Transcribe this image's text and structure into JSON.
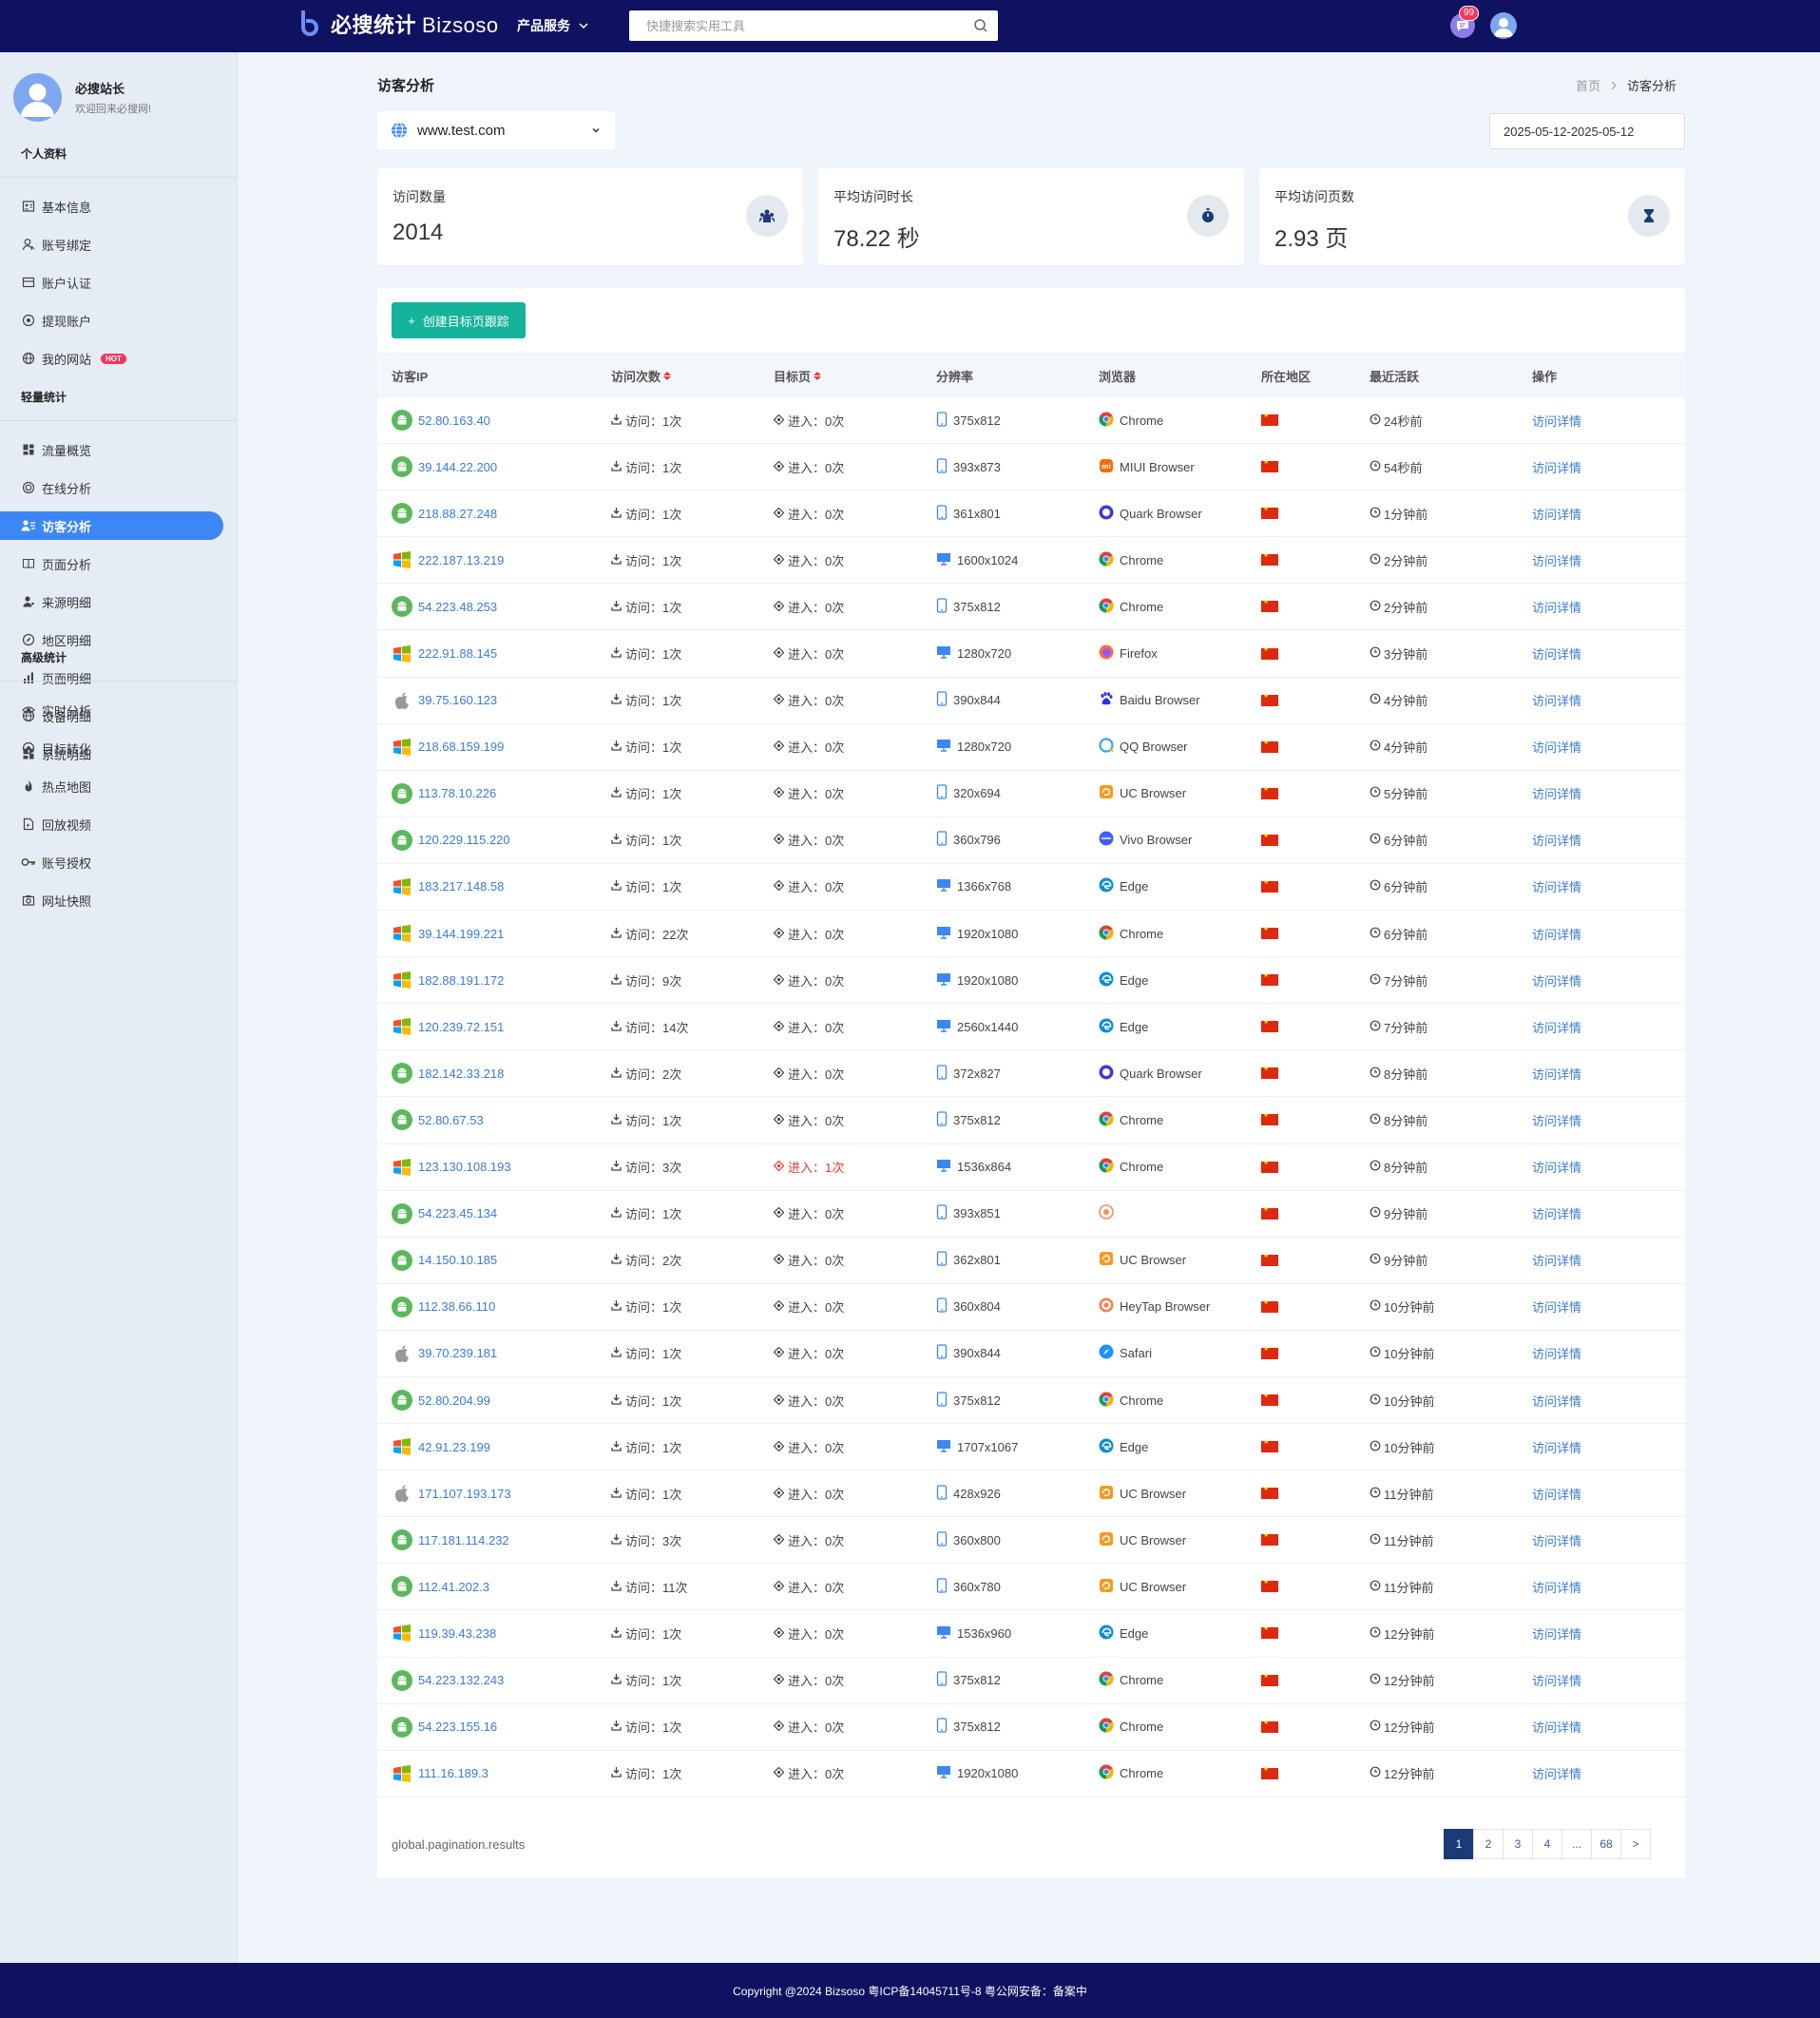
{
  "header": {
    "logo_cn": "必搜统计",
    "logo_en": "Bizsoso",
    "product_menu": "产品服务",
    "search_placeholder": "快捷搜索实用工具",
    "message_badge": "99"
  },
  "sidebar": {
    "user_name": "必搜站长",
    "user_welcome": "欢迎回来必搜网!",
    "sections": [
      {
        "title": "个人资料",
        "items": [
          {
            "label": "基本信息",
            "icon": "id-card-icon"
          },
          {
            "label": "账号绑定",
            "icon": "user-icon"
          },
          {
            "label": "账户认证",
            "icon": "card-icon"
          },
          {
            "label": "提现账户",
            "icon": "target-icon"
          },
          {
            "label": "我的网站",
            "icon": "globe-icon",
            "badge": "HOT"
          }
        ]
      },
      {
        "title": "轻量统计",
        "items": [
          {
            "label": "流量概览",
            "icon": "dashboard-icon"
          },
          {
            "label": "在线分析",
            "icon": "online-icon"
          },
          {
            "label": "访客分析",
            "icon": "users-icon",
            "active": true
          },
          {
            "label": "页面分析",
            "icon": "book-icon"
          },
          {
            "label": "来源明细",
            "icon": "person-icon"
          },
          {
            "label": "地区明细",
            "icon": "compass-icon"
          },
          {
            "label": "页面明细",
            "icon": "bar-chart-icon"
          },
          {
            "label": "设备明细",
            "icon": "globe-icon"
          },
          {
            "label": "系统明细",
            "icon": "dashboard-icon"
          }
        ]
      },
      {
        "title": "高级统计",
        "items": [
          {
            "label": "实时分析",
            "icon": "eye-icon"
          },
          {
            "label": "目标转化",
            "icon": "target-icon"
          },
          {
            "label": "热点地图",
            "icon": "flame-icon"
          },
          {
            "label": "回放视频",
            "icon": "file-icon"
          },
          {
            "label": "账号授权",
            "icon": "key-icon"
          },
          {
            "label": "网址快照",
            "icon": "camera-icon"
          }
        ]
      }
    ]
  },
  "page": {
    "title": "访客分析",
    "breadcrumb_home": "首页",
    "breadcrumb_current": "访客分析",
    "site": "www.test.com",
    "date_range": "2025-05-12-2025-05-12"
  },
  "stats": [
    {
      "label": "访问数量",
      "value": "2014",
      "icon": "visitors-icon"
    },
    {
      "label": "平均访问时长",
      "value": "78.22 秒",
      "icon": "stopwatch-icon"
    },
    {
      "label": "平均访问页数",
      "value": "2.93 页",
      "icon": "hourglass-icon"
    }
  ],
  "table": {
    "create_button": "创建目标页跟踪",
    "columns": [
      "访客IP",
      "访问次数",
      "目标页",
      "分辨率",
      "浏览器",
      "所在地区",
      "最近活跃",
      "操作"
    ],
    "visit_prefix": "访问：",
    "enter_prefix": "进入：",
    "detail_label": "访问详情",
    "rows": [
      {
        "os": "android",
        "ip": "52.80.163.40",
        "visits": "1次",
        "target": "0次",
        "device": "mobile",
        "res": "375x812",
        "browser": "Chrome",
        "bicon": "chrome",
        "time": "24秒前"
      },
      {
        "os": "android",
        "ip": "39.144.22.200",
        "visits": "1次",
        "target": "0次",
        "device": "mobile",
        "res": "393x873",
        "browser": "MIUI Browser",
        "bicon": "miui",
        "time": "54秒前"
      },
      {
        "os": "android",
        "ip": "218.88.27.248",
        "visits": "1次",
        "target": "0次",
        "device": "mobile",
        "res": "361x801",
        "browser": "Quark Browser",
        "bicon": "quark",
        "time": "1分钟前"
      },
      {
        "os": "windows",
        "ip": "222.187.13.219",
        "visits": "1次",
        "target": "0次",
        "device": "desktop",
        "res": "1600x1024",
        "browser": "Chrome",
        "bicon": "chrome",
        "time": "2分钟前"
      },
      {
        "os": "android",
        "ip": "54.223.48.253",
        "visits": "1次",
        "target": "0次",
        "device": "mobile",
        "res": "375x812",
        "browser": "Chrome",
        "bicon": "chrome",
        "time": "2分钟前"
      },
      {
        "os": "windows",
        "ip": "222.91.88.145",
        "visits": "1次",
        "target": "0次",
        "device": "desktop",
        "res": "1280x720",
        "browser": "Firefox",
        "bicon": "firefox",
        "time": "3分钟前"
      },
      {
        "os": "apple",
        "ip": "39.75.160.123",
        "visits": "1次",
        "target": "0次",
        "device": "mobile",
        "res": "390x844",
        "browser": "Baidu Browser",
        "bicon": "baidu",
        "time": "4分钟前"
      },
      {
        "os": "windows",
        "ip": "218.68.159.199",
        "visits": "1次",
        "target": "0次",
        "device": "desktop",
        "res": "1280x720",
        "browser": "QQ Browser",
        "bicon": "qq",
        "time": "4分钟前"
      },
      {
        "os": "android",
        "ip": "113.78.10.226",
        "visits": "1次",
        "target": "0次",
        "device": "mobile",
        "res": "320x694",
        "browser": "UC Browser",
        "bicon": "uc",
        "time": "5分钟前"
      },
      {
        "os": "android",
        "ip": "120.229.115.220",
        "visits": "1次",
        "target": "0次",
        "device": "mobile",
        "res": "360x796",
        "browser": "Vivo Browser",
        "bicon": "vivo",
        "time": "6分钟前"
      },
      {
        "os": "windows",
        "ip": "183.217.148.58",
        "visits": "1次",
        "target": "0次",
        "device": "desktop",
        "res": "1366x768",
        "browser": "Edge",
        "bicon": "edge",
        "time": "6分钟前"
      },
      {
        "os": "windows",
        "ip": "39.144.199.221",
        "visits": "22次",
        "target": "0次",
        "device": "desktop",
        "res": "1920x1080",
        "browser": "Chrome",
        "bicon": "chrome",
        "time": "6分钟前"
      },
      {
        "os": "windows",
        "ip": "182.88.191.172",
        "visits": "9次",
        "target": "0次",
        "device": "desktop",
        "res": "1920x1080",
        "browser": "Edge",
        "bicon": "edge",
        "time": "7分钟前"
      },
      {
        "os": "windows",
        "ip": "120.239.72.151",
        "visits": "14次",
        "target": "0次",
        "device": "desktop",
        "res": "2560x1440",
        "browser": "Edge",
        "bicon": "edge",
        "time": "7分钟前"
      },
      {
        "os": "android",
        "ip": "182.142.33.218",
        "visits": "2次",
        "target": "0次",
        "device": "mobile",
        "res": "372x827",
        "browser": "Quark Browser",
        "bicon": "quark",
        "time": "8分钟前"
      },
      {
        "os": "android",
        "ip": "52.80.67.53",
        "visits": "1次",
        "target": "0次",
        "device": "mobile",
        "res": "375x812",
        "browser": "Chrome",
        "bicon": "chrome",
        "time": "8分钟前"
      },
      {
        "os": "windows",
        "ip": "123.130.108.193",
        "visits": "3次",
        "target": "1次",
        "hit": true,
        "device": "desktop",
        "res": "1536x864",
        "browser": "Chrome",
        "bicon": "chrome",
        "time": "8分钟前"
      },
      {
        "os": "android",
        "ip": "54.223.45.134",
        "visits": "1次",
        "target": "0次",
        "device": "mobile",
        "res": "393x851",
        "browser": "",
        "bicon": "unknown",
        "time": "9分钟前"
      },
      {
        "os": "android",
        "ip": "14.150.10.185",
        "visits": "2次",
        "target": "0次",
        "device": "mobile",
        "res": "362x801",
        "browser": "UC Browser",
        "bicon": "uc",
        "time": "9分钟前"
      },
      {
        "os": "android",
        "ip": "112.38.66.110",
        "visits": "1次",
        "target": "0次",
        "device": "mobile",
        "res": "360x804",
        "browser": "HeyTap Browser",
        "bicon": "heytap",
        "time": "10分钟前"
      },
      {
        "os": "apple",
        "ip": "39.70.239.181",
        "visits": "1次",
        "target": "0次",
        "device": "mobile",
        "res": "390x844",
        "browser": "Safari",
        "bicon": "safari",
        "time": "10分钟前"
      },
      {
        "os": "android",
        "ip": "52.80.204.99",
        "visits": "1次",
        "target": "0次",
        "device": "mobile",
        "res": "375x812",
        "browser": "Chrome",
        "bicon": "chrome",
        "time": "10分钟前"
      },
      {
        "os": "windows",
        "ip": "42.91.23.199",
        "visits": "1次",
        "target": "0次",
        "device": "desktop",
        "res": "1707x1067",
        "browser": "Edge",
        "bicon": "edge",
        "time": "10分钟前"
      },
      {
        "os": "apple",
        "ip": "171.107.193.173",
        "visits": "1次",
        "target": "0次",
        "device": "mobile",
        "res": "428x926",
        "browser": "UC Browser",
        "bicon": "uc",
        "time": "11分钟前"
      },
      {
        "os": "android",
        "ip": "117.181.114.232",
        "visits": "3次",
        "target": "0次",
        "device": "mobile",
        "res": "360x800",
        "browser": "UC Browser",
        "bicon": "uc",
        "time": "11分钟前"
      },
      {
        "os": "android",
        "ip": "112.41.202.3",
        "visits": "11次",
        "target": "0次",
        "device": "mobile",
        "res": "360x780",
        "browser": "UC Browser",
        "bicon": "uc",
        "time": "11分钟前"
      },
      {
        "os": "windows",
        "ip": "119.39.43.238",
        "visits": "1次",
        "target": "0次",
        "device": "desktop",
        "res": "1536x960",
        "browser": "Edge",
        "bicon": "edge",
        "time": "12分钟前"
      },
      {
        "os": "android",
        "ip": "54.223.132.243",
        "visits": "1次",
        "target": "0次",
        "device": "mobile",
        "res": "375x812",
        "browser": "Chrome",
        "bicon": "chrome",
        "time": "12分钟前"
      },
      {
        "os": "android",
        "ip": "54.223.155.16",
        "visits": "1次",
        "target": "0次",
        "device": "mobile",
        "res": "375x812",
        "browser": "Chrome",
        "bicon": "chrome",
        "time": "12分钟前"
      },
      {
        "os": "windows",
        "ip": "111.16.189.3",
        "visits": "1次",
        "target": "0次",
        "device": "desktop",
        "res": "1920x1080",
        "browser": "Chrome",
        "bicon": "chrome",
        "time": "12分钟前"
      }
    ]
  },
  "pagination": {
    "results_text": "global.pagination.results",
    "pages": [
      "1",
      "2",
      "3",
      "4",
      "...",
      "68",
      ">"
    ],
    "current": "1"
  },
  "footer": {
    "copyright": "Copyright @2024 Bizsoso 粤ICP备14045711号-8 粤公网安备：备案中"
  }
}
